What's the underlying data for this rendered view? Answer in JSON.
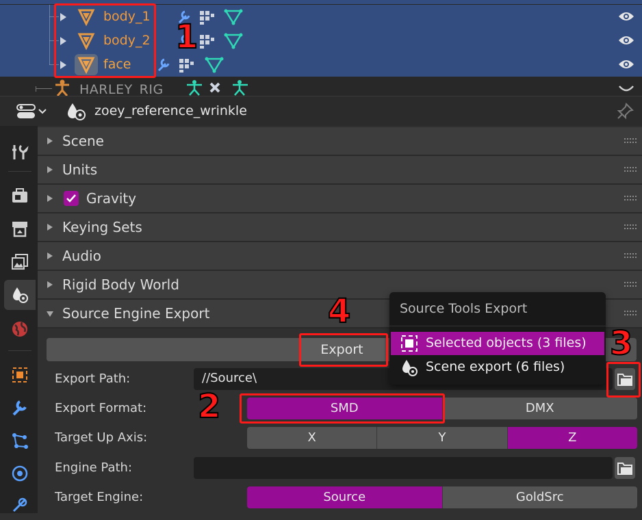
{
  "outliner": {
    "rows": [
      {
        "name": "body_1",
        "selected": true
      },
      {
        "name": "body_2",
        "selected": true
      },
      {
        "name": "face",
        "selected": true,
        "active": true
      },
      {
        "name": "HARLEY_RIG",
        "selected": false
      }
    ]
  },
  "properties": {
    "context_title": "zoey_reference_wrinkle",
    "panels": [
      {
        "label": "Scene",
        "expanded": false
      },
      {
        "label": "Units",
        "expanded": false
      },
      {
        "label": "Gravity",
        "expanded": false,
        "checked": true
      },
      {
        "label": "Keying Sets",
        "expanded": false
      },
      {
        "label": "Audio",
        "expanded": false
      },
      {
        "label": "Rigid Body World",
        "expanded": false
      },
      {
        "label": "Source Engine Export",
        "expanded": true
      }
    ],
    "source_export": {
      "export_button": "Export",
      "export_path_label": "Export Path:",
      "export_path_value": "//Source\\",
      "export_format_label": "Export Format:",
      "export_format_options": [
        "SMD",
        "DMX"
      ],
      "export_format_selected": "SMD",
      "target_up_axis_label": "Target Up Axis:",
      "target_up_axis_options": [
        "X",
        "Y",
        "Z"
      ],
      "target_up_axis_selected": "Z",
      "engine_path_label": "Engine Path:",
      "engine_path_value": "",
      "target_engine_label": "Target Engine:",
      "target_engine_options": [
        "Source",
        "GoldSrc"
      ],
      "target_engine_selected": "Source"
    }
  },
  "export_menu": {
    "title": "Source Tools Export",
    "items": [
      {
        "label": "Selected objects (3 files)",
        "highlighted": true
      },
      {
        "label": "Scene export (6 files)",
        "highlighted": false
      }
    ]
  },
  "annotations": {
    "n1": "1",
    "n2": "2",
    "n3": "3",
    "n4": "4"
  },
  "colors": {
    "selection_blue": "#334d80",
    "accent_magenta": "#960c95",
    "annotation_red": "#ff1a1a",
    "object_orange": "#f29a3a"
  }
}
